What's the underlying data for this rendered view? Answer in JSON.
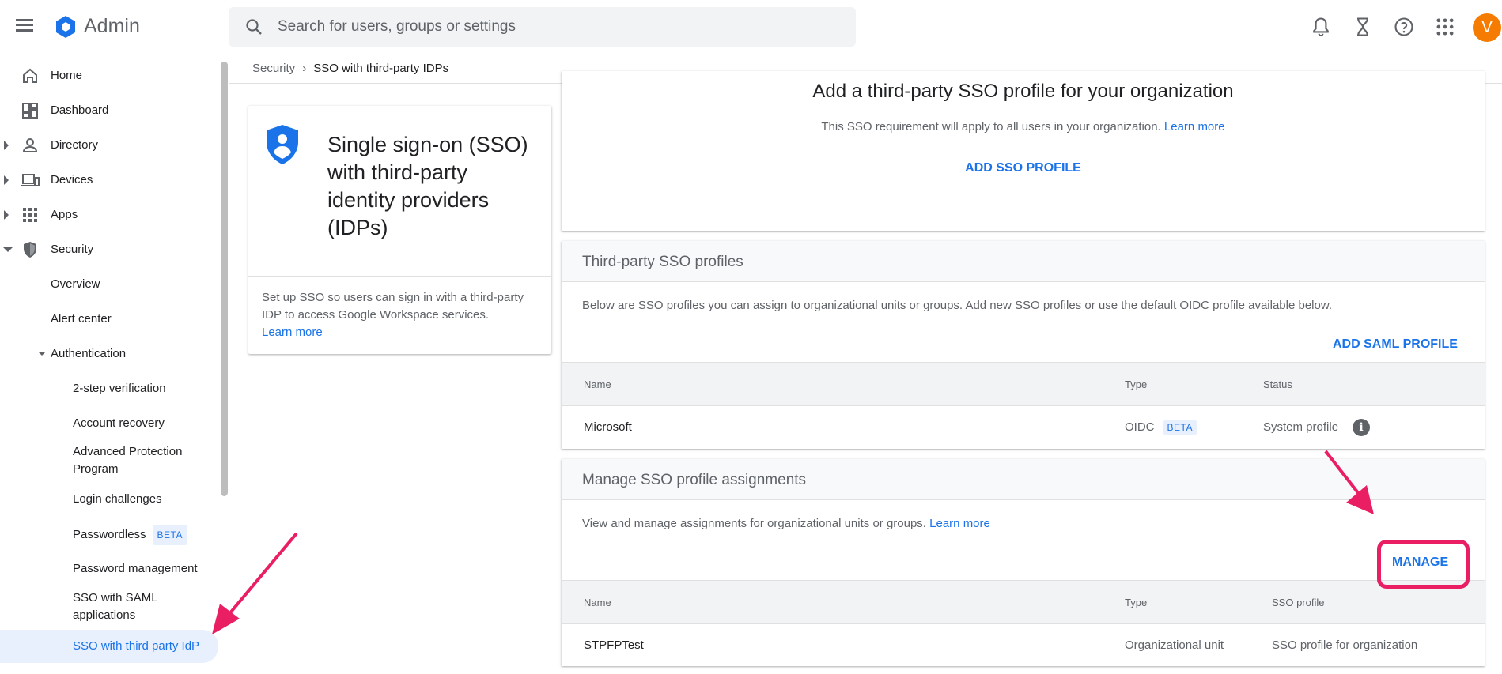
{
  "app": {
    "title": "Admin",
    "avatar_letter": "V"
  },
  "search": {
    "placeholder": "Search for users, groups or settings"
  },
  "topbar_icons": [
    "bell-icon",
    "hourglass-icon",
    "help-icon",
    "apps-grid-icon"
  ],
  "sidebar": {
    "items": [
      {
        "label": "Home",
        "icon": "home-icon"
      },
      {
        "label": "Dashboard",
        "icon": "dashboard-icon"
      },
      {
        "label": "Directory",
        "icon": "person-icon"
      },
      {
        "label": "Devices",
        "icon": "devices-icon"
      },
      {
        "label": "Apps",
        "icon": "apps-icon"
      },
      {
        "label": "Security",
        "icon": "shield-icon"
      }
    ],
    "security_sub": {
      "overview": "Overview",
      "alert_center": "Alert center",
      "authentication": "Authentication"
    },
    "auth_sub": {
      "two_step": "2-step verification",
      "account_recovery": "Account recovery",
      "advanced_protection_1": "Advanced Protection",
      "advanced_protection_2": "Program",
      "login_challenges": "Login challenges",
      "passwordless": "Passwordless",
      "passwordless_badge": "BETA",
      "password_management": "Password management",
      "sso_saml_1": "SSO with SAML",
      "sso_saml_2": "applications",
      "sso_third_party": "SSO with third party IdP"
    }
  },
  "breadcrumb": {
    "parent": "Security",
    "current": "SSO with third-party IDPs"
  },
  "info_card": {
    "title": "Single sign-on (SSO) with third-party identity providers (IDPs)",
    "description": "Set up SSO so users can sign in with a third-party IDP to access Google Workspace services.",
    "link": "Learn more"
  },
  "add_profile_card": {
    "heading": "Add a third-party SSO profile for your organization",
    "subtext": "This SSO requirement will apply to all users in your organization.",
    "link": "Learn more",
    "button": "ADD SSO PROFILE"
  },
  "profiles_card": {
    "title": "Third-party SSO profiles",
    "description": "Below are SSO profiles you can assign to organizational units or groups. Add new SSO profiles or use the default OIDC profile available below.",
    "button": "ADD SAML PROFILE",
    "columns": {
      "name": "Name",
      "type": "Type",
      "status": "Status"
    },
    "rows": [
      {
        "name": "Microsoft",
        "type": "OIDC",
        "badge": "BETA",
        "status": "System profile"
      }
    ]
  },
  "assignments_card": {
    "title": "Manage SSO profile assignments",
    "description": "View and manage assignments for organizational units or groups.",
    "link": "Learn more",
    "button": "MANAGE",
    "columns": {
      "name": "Name",
      "type": "Type",
      "profile": "SSO profile"
    },
    "rows": [
      {
        "name": "STPFPTest",
        "type": "Organizational unit",
        "profile": "SSO profile for organization"
      }
    ]
  },
  "colors": {
    "accent": "#1a73e8",
    "annotation": "#e91e63",
    "avatar": "#f57c00"
  }
}
